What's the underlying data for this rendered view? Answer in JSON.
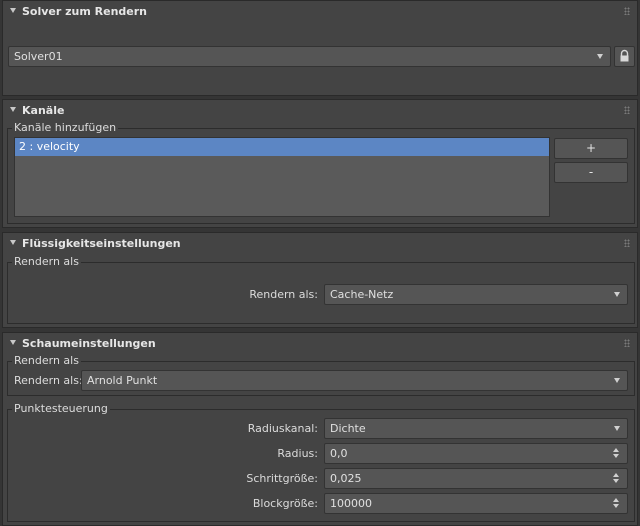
{
  "solver_rollout": {
    "title": "Solver zum Rendern",
    "solver_dropdown": {
      "value": "Solver01"
    },
    "lock_icon": "lock-icon"
  },
  "channels_rollout": {
    "title": "Kanäle",
    "group_label": "Kanäle hinzufügen",
    "items": [
      {
        "label": "2 : velocity",
        "selected": true
      }
    ],
    "add_button": "+",
    "remove_button": "-"
  },
  "fluid_rollout": {
    "title": "Flüssigkeitseinstellungen",
    "group_label": "Rendern als",
    "render_as_label": "Rendern als:",
    "render_as_value": "Cache-Netz"
  },
  "foam_rollout": {
    "title": "Schaumeinstellungen",
    "render_group_label": "Rendern als",
    "render_as_label": "Rendern als:",
    "render_as_value": "Arnold Punkt",
    "point_group_label": "Punktesteuerung",
    "radius_channel_label": "Radiuskanal:",
    "radius_channel_value": "Dichte",
    "radius_label": "Radius:",
    "radius_value": "0,0",
    "step_size_label": "Schrittgröße:",
    "step_size_value": "0,025",
    "block_size_label": "Blockgröße:",
    "block_size_value": "100000"
  },
  "colors": {
    "panel_bg": "#444444",
    "field_bg": "#555555",
    "selection": "#5c86c4",
    "text": "#dcdcdc"
  }
}
